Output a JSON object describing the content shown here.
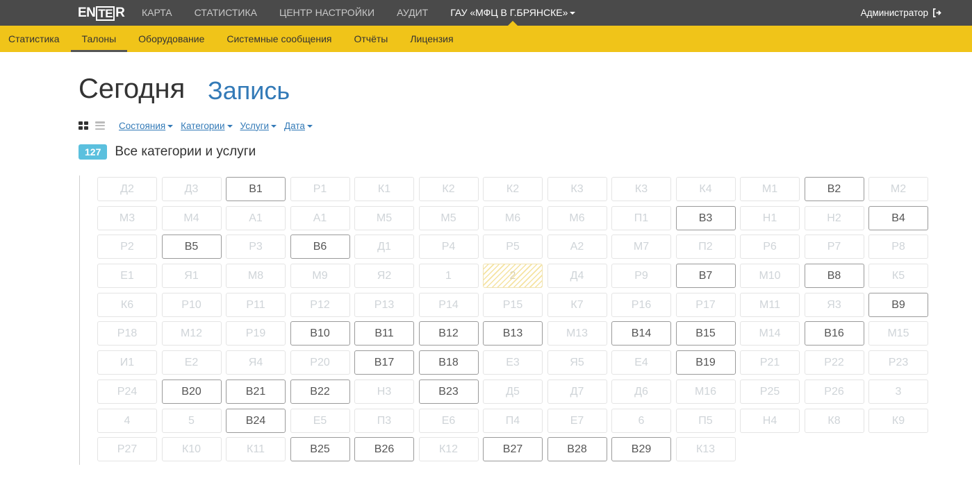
{
  "topnav": {
    "logo": {
      "pre": "EN",
      "boxed": "TE",
      "post": "R"
    },
    "items": [
      {
        "label": "КАРТА",
        "active": false
      },
      {
        "label": "СТАТИСТИКА",
        "active": false
      },
      {
        "label": "ЦЕНТР НАСТРОЙКИ",
        "active": false
      },
      {
        "label": "АУДИТ",
        "active": false
      },
      {
        "label": "ГАУ «МФЦ В Г.БРЯНСКЕ»",
        "active": true
      }
    ],
    "user": "Администратор"
  },
  "subnav": {
    "items": [
      {
        "label": "Статистика",
        "active": false
      },
      {
        "label": "Талоны",
        "active": true
      },
      {
        "label": "Оборудование",
        "active": false
      },
      {
        "label": "Системные сообщения",
        "active": false
      },
      {
        "label": "Отчёты",
        "active": false
      },
      {
        "label": "Лицензия",
        "active": false
      }
    ]
  },
  "header": {
    "today": "Сегодня",
    "record": "Запись"
  },
  "filters": [
    "Состояния",
    "Категории",
    "Услуги",
    "Дата"
  ],
  "count": {
    "value": "127",
    "label": "Все категории и услуги"
  },
  "tickets": [
    {
      "l": "Д2",
      "s": "i"
    },
    {
      "l": "Д3",
      "s": "i"
    },
    {
      "l": "В1",
      "s": "a"
    },
    {
      "l": "Р1",
      "s": "i"
    },
    {
      "l": "К1",
      "s": "i"
    },
    {
      "l": "К2",
      "s": "i"
    },
    {
      "l": "К2",
      "s": "i"
    },
    {
      "l": "К3",
      "s": "i"
    },
    {
      "l": "К3",
      "s": "i"
    },
    {
      "l": "К4",
      "s": "i"
    },
    {
      "l": "М1",
      "s": "i"
    },
    {
      "l": "В2",
      "s": "a"
    },
    {
      "l": "М2",
      "s": "i"
    },
    {
      "l": "М3",
      "s": "i"
    },
    {
      "l": "М4",
      "s": "i"
    },
    {
      "l": "А1",
      "s": "i"
    },
    {
      "l": "А1",
      "s": "i"
    },
    {
      "l": "М5",
      "s": "i"
    },
    {
      "l": "М5",
      "s": "i"
    },
    {
      "l": "М6",
      "s": "i"
    },
    {
      "l": "М6",
      "s": "i"
    },
    {
      "l": "П1",
      "s": "i"
    },
    {
      "l": "В3",
      "s": "a"
    },
    {
      "l": "Н1",
      "s": "i"
    },
    {
      "l": "Н2",
      "s": "i"
    },
    {
      "l": "В4",
      "s": "a"
    },
    {
      "l": "Р2",
      "s": "i"
    },
    {
      "l": "В5",
      "s": "a"
    },
    {
      "l": "Р3",
      "s": "i"
    },
    {
      "l": "В6",
      "s": "a"
    },
    {
      "l": "Д1",
      "s": "i"
    },
    {
      "l": "Р4",
      "s": "i"
    },
    {
      "l": "Р5",
      "s": "i"
    },
    {
      "l": "А2",
      "s": "i"
    },
    {
      "l": "М7",
      "s": "i"
    },
    {
      "l": "П2",
      "s": "i"
    },
    {
      "l": "Р6",
      "s": "i"
    },
    {
      "l": "Р7",
      "s": "i"
    },
    {
      "l": "Р8",
      "s": "i"
    },
    {
      "l": "Е1",
      "s": "i"
    },
    {
      "l": "Я1",
      "s": "i"
    },
    {
      "l": "М8",
      "s": "i"
    },
    {
      "l": "М9",
      "s": "i"
    },
    {
      "l": "Я2",
      "s": "i"
    },
    {
      "l": "1",
      "s": "i"
    },
    {
      "l": "2",
      "s": "h"
    },
    {
      "l": "Д4",
      "s": "i"
    },
    {
      "l": "Р9",
      "s": "i"
    },
    {
      "l": "В7",
      "s": "a"
    },
    {
      "l": "М10",
      "s": "i"
    },
    {
      "l": "В8",
      "s": "a"
    },
    {
      "l": "К5",
      "s": "i"
    },
    {
      "l": "К6",
      "s": "i"
    },
    {
      "l": "Р10",
      "s": "i"
    },
    {
      "l": "Р11",
      "s": "i"
    },
    {
      "l": "Р12",
      "s": "i"
    },
    {
      "l": "Р13",
      "s": "i"
    },
    {
      "l": "Р14",
      "s": "i"
    },
    {
      "l": "Р15",
      "s": "i"
    },
    {
      "l": "К7",
      "s": "i"
    },
    {
      "l": "Р16",
      "s": "i"
    },
    {
      "l": "Р17",
      "s": "i"
    },
    {
      "l": "М11",
      "s": "i"
    },
    {
      "l": "Я3",
      "s": "i"
    },
    {
      "l": "В9",
      "s": "a"
    },
    {
      "l": "Р18",
      "s": "i"
    },
    {
      "l": "М12",
      "s": "i"
    },
    {
      "l": "Р19",
      "s": "i"
    },
    {
      "l": "В10",
      "s": "a"
    },
    {
      "l": "В11",
      "s": "a"
    },
    {
      "l": "В12",
      "s": "a"
    },
    {
      "l": "В13",
      "s": "a"
    },
    {
      "l": "М13",
      "s": "i"
    },
    {
      "l": "В14",
      "s": "a"
    },
    {
      "l": "В15",
      "s": "a"
    },
    {
      "l": "М14",
      "s": "i"
    },
    {
      "l": "В16",
      "s": "a"
    },
    {
      "l": "М15",
      "s": "i"
    },
    {
      "l": "И1",
      "s": "i"
    },
    {
      "l": "Е2",
      "s": "i"
    },
    {
      "l": "Я4",
      "s": "i"
    },
    {
      "l": "Р20",
      "s": "i"
    },
    {
      "l": "В17",
      "s": "a"
    },
    {
      "l": "В18",
      "s": "a"
    },
    {
      "l": "Е3",
      "s": "i"
    },
    {
      "l": "Я5",
      "s": "i"
    },
    {
      "l": "Е4",
      "s": "i"
    },
    {
      "l": "В19",
      "s": "a"
    },
    {
      "l": "Р21",
      "s": "i"
    },
    {
      "l": "Р22",
      "s": "i"
    },
    {
      "l": "Р23",
      "s": "i"
    },
    {
      "l": "Р24",
      "s": "i"
    },
    {
      "l": "В20",
      "s": "a"
    },
    {
      "l": "В21",
      "s": "a"
    },
    {
      "l": "В22",
      "s": "a"
    },
    {
      "l": "Н3",
      "s": "i"
    },
    {
      "l": "В23",
      "s": "a"
    },
    {
      "l": "Д5",
      "s": "i"
    },
    {
      "l": "Д7",
      "s": "i"
    },
    {
      "l": "Д6",
      "s": "i"
    },
    {
      "l": "М16",
      "s": "i"
    },
    {
      "l": "Р25",
      "s": "i"
    },
    {
      "l": "Р26",
      "s": "i"
    },
    {
      "l": "3",
      "s": "i"
    },
    {
      "l": "4",
      "s": "i"
    },
    {
      "l": "5",
      "s": "i"
    },
    {
      "l": "В24",
      "s": "a"
    },
    {
      "l": "Е5",
      "s": "i"
    },
    {
      "l": "П3",
      "s": "i"
    },
    {
      "l": "Е6",
      "s": "i"
    },
    {
      "l": "П4",
      "s": "i"
    },
    {
      "l": "Е7",
      "s": "i"
    },
    {
      "l": "6",
      "s": "i"
    },
    {
      "l": "П5",
      "s": "i"
    },
    {
      "l": "Н4",
      "s": "i"
    },
    {
      "l": "К8",
      "s": "i"
    },
    {
      "l": "К9",
      "s": "i"
    },
    {
      "l": "Р27",
      "s": "i"
    },
    {
      "l": "К10",
      "s": "i"
    },
    {
      "l": "К11",
      "s": "i"
    },
    {
      "l": "В25",
      "s": "a"
    },
    {
      "l": "В26",
      "s": "a"
    },
    {
      "l": "К12",
      "s": "i"
    },
    {
      "l": "В27",
      "s": "a"
    },
    {
      "l": "В28",
      "s": "a"
    },
    {
      "l": "В29",
      "s": "a"
    },
    {
      "l": "К13",
      "s": "i"
    }
  ]
}
